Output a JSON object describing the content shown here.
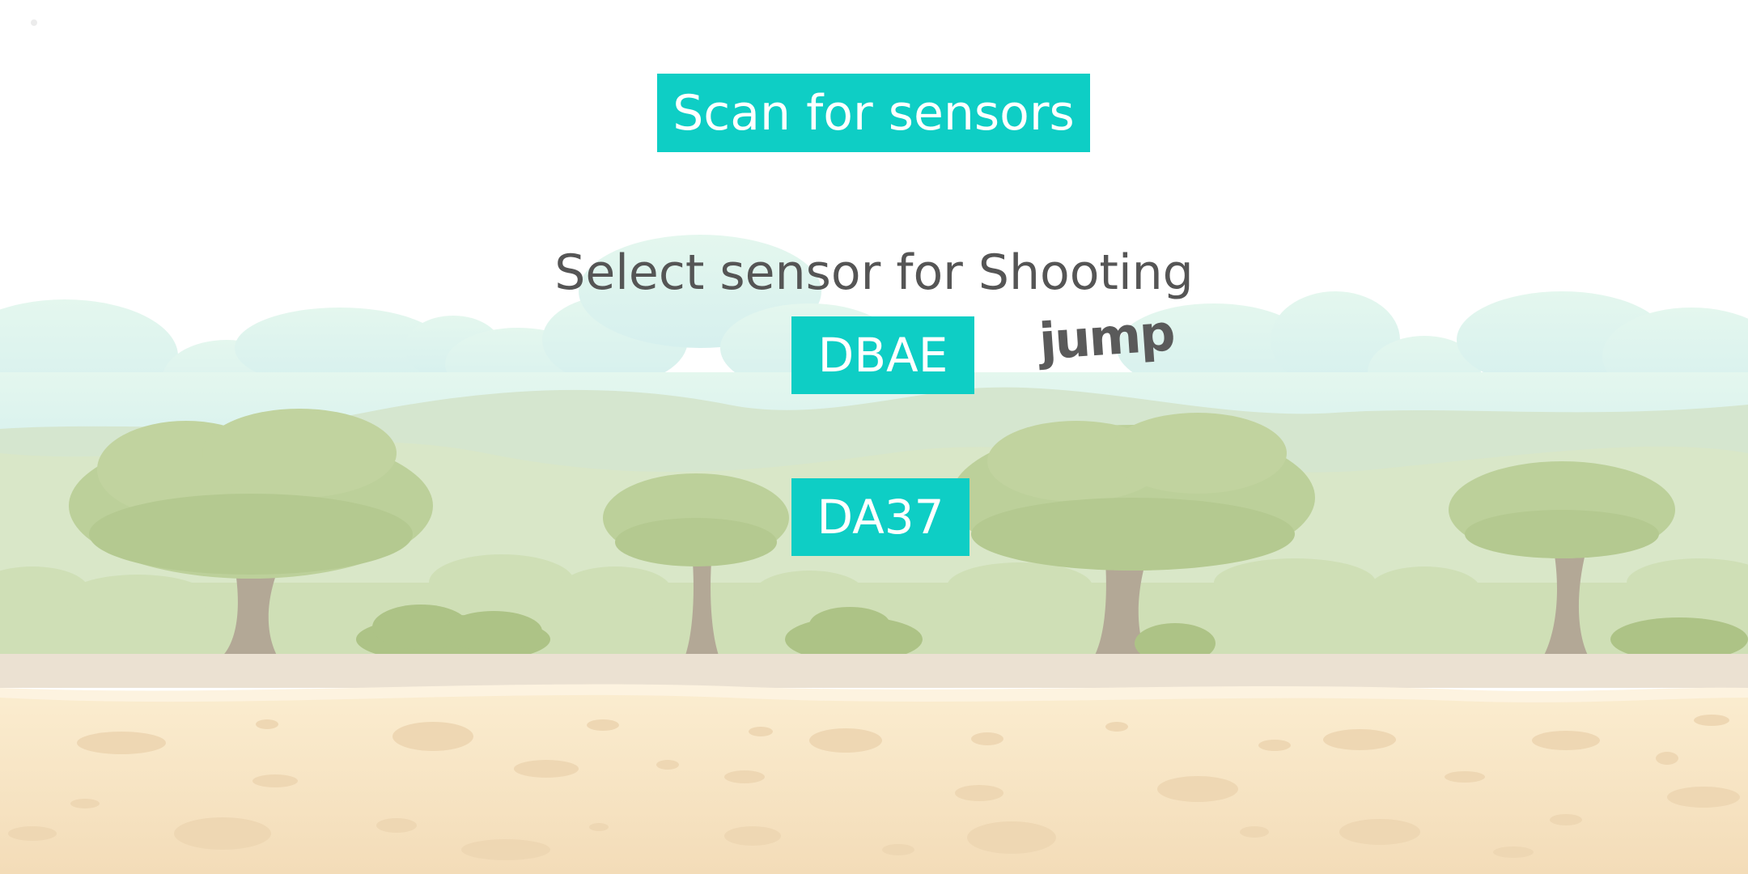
{
  "scan_button": {
    "label": "Scan for sensors"
  },
  "sensor_prompt": "Select sensor for Shooting",
  "sensors": [
    {
      "label": "DBAE"
    },
    {
      "label": "DA37"
    }
  ],
  "jump_label": "jump",
  "colors": {
    "button_background": "#0ecec5",
    "button_text": "#ffffff",
    "heading_text": "#555555",
    "jump_text": "#5a5a5a",
    "sky_clouds": "#dff6ee",
    "hills": "#d9e7c8",
    "tree_foliage": "#bcd09a",
    "tree_trunk": "#b3a896",
    "ground": "#f6e3c0"
  }
}
